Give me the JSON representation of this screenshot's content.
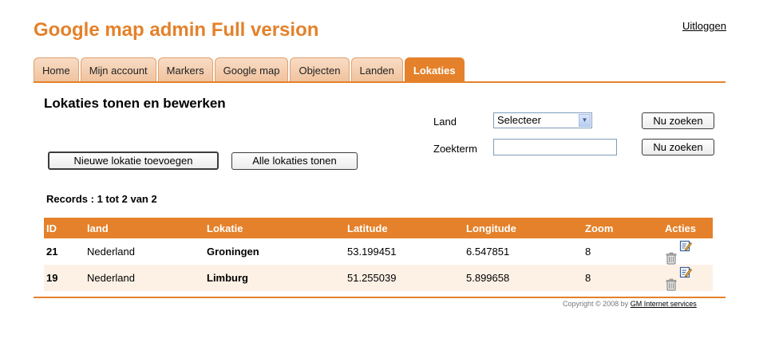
{
  "header": {
    "title": "Google map admin Full version",
    "logout": "Uitloggen"
  },
  "tabs": [
    {
      "label": "Home",
      "active": false
    },
    {
      "label": "Mijn account",
      "active": false
    },
    {
      "label": "Markers",
      "active": false
    },
    {
      "label": "Google map",
      "active": false
    },
    {
      "label": "Objecten",
      "active": false
    },
    {
      "label": "Landen",
      "active": false
    },
    {
      "label": "Lokaties",
      "active": true
    }
  ],
  "page": {
    "heading": "Lokaties tonen en bewerken"
  },
  "search": {
    "land_label": "Land",
    "land_value": "Selecteer",
    "zoekterm_label": "Zoekterm",
    "zoekterm_value": "",
    "search_button_1": "Nu zoeken",
    "search_button_2": "Nu zoeken"
  },
  "actions": {
    "add_button": "Nieuwe lokatie toevoegen",
    "show_all_button": "Alle lokaties tonen"
  },
  "records_text": "Records : 1 tot 2 van 2",
  "table": {
    "headers": [
      "ID",
      "land",
      "Lokatie",
      "Latitude",
      "Longitude",
      "Zoom",
      "Acties"
    ],
    "rows": [
      {
        "id": "21",
        "land": "Nederland",
        "lokatie": "Groningen",
        "latitude": "53.199451",
        "longitude": "6.547851",
        "zoom": "8"
      },
      {
        "id": "19",
        "land": "Nederland",
        "lokatie": "Limburg",
        "latitude": "51.255039",
        "longitude": "5.899658",
        "zoom": "8"
      }
    ]
  },
  "footer": {
    "copyright": "Copyright © 2008 by",
    "link": "GM Internet services"
  },
  "colors": {
    "accent": "#e4812a",
    "row_alt": "#fdf1e6"
  },
  "icons": [
    "edit-icon",
    "trash-icon",
    "dropdown-arrow-icon"
  ]
}
